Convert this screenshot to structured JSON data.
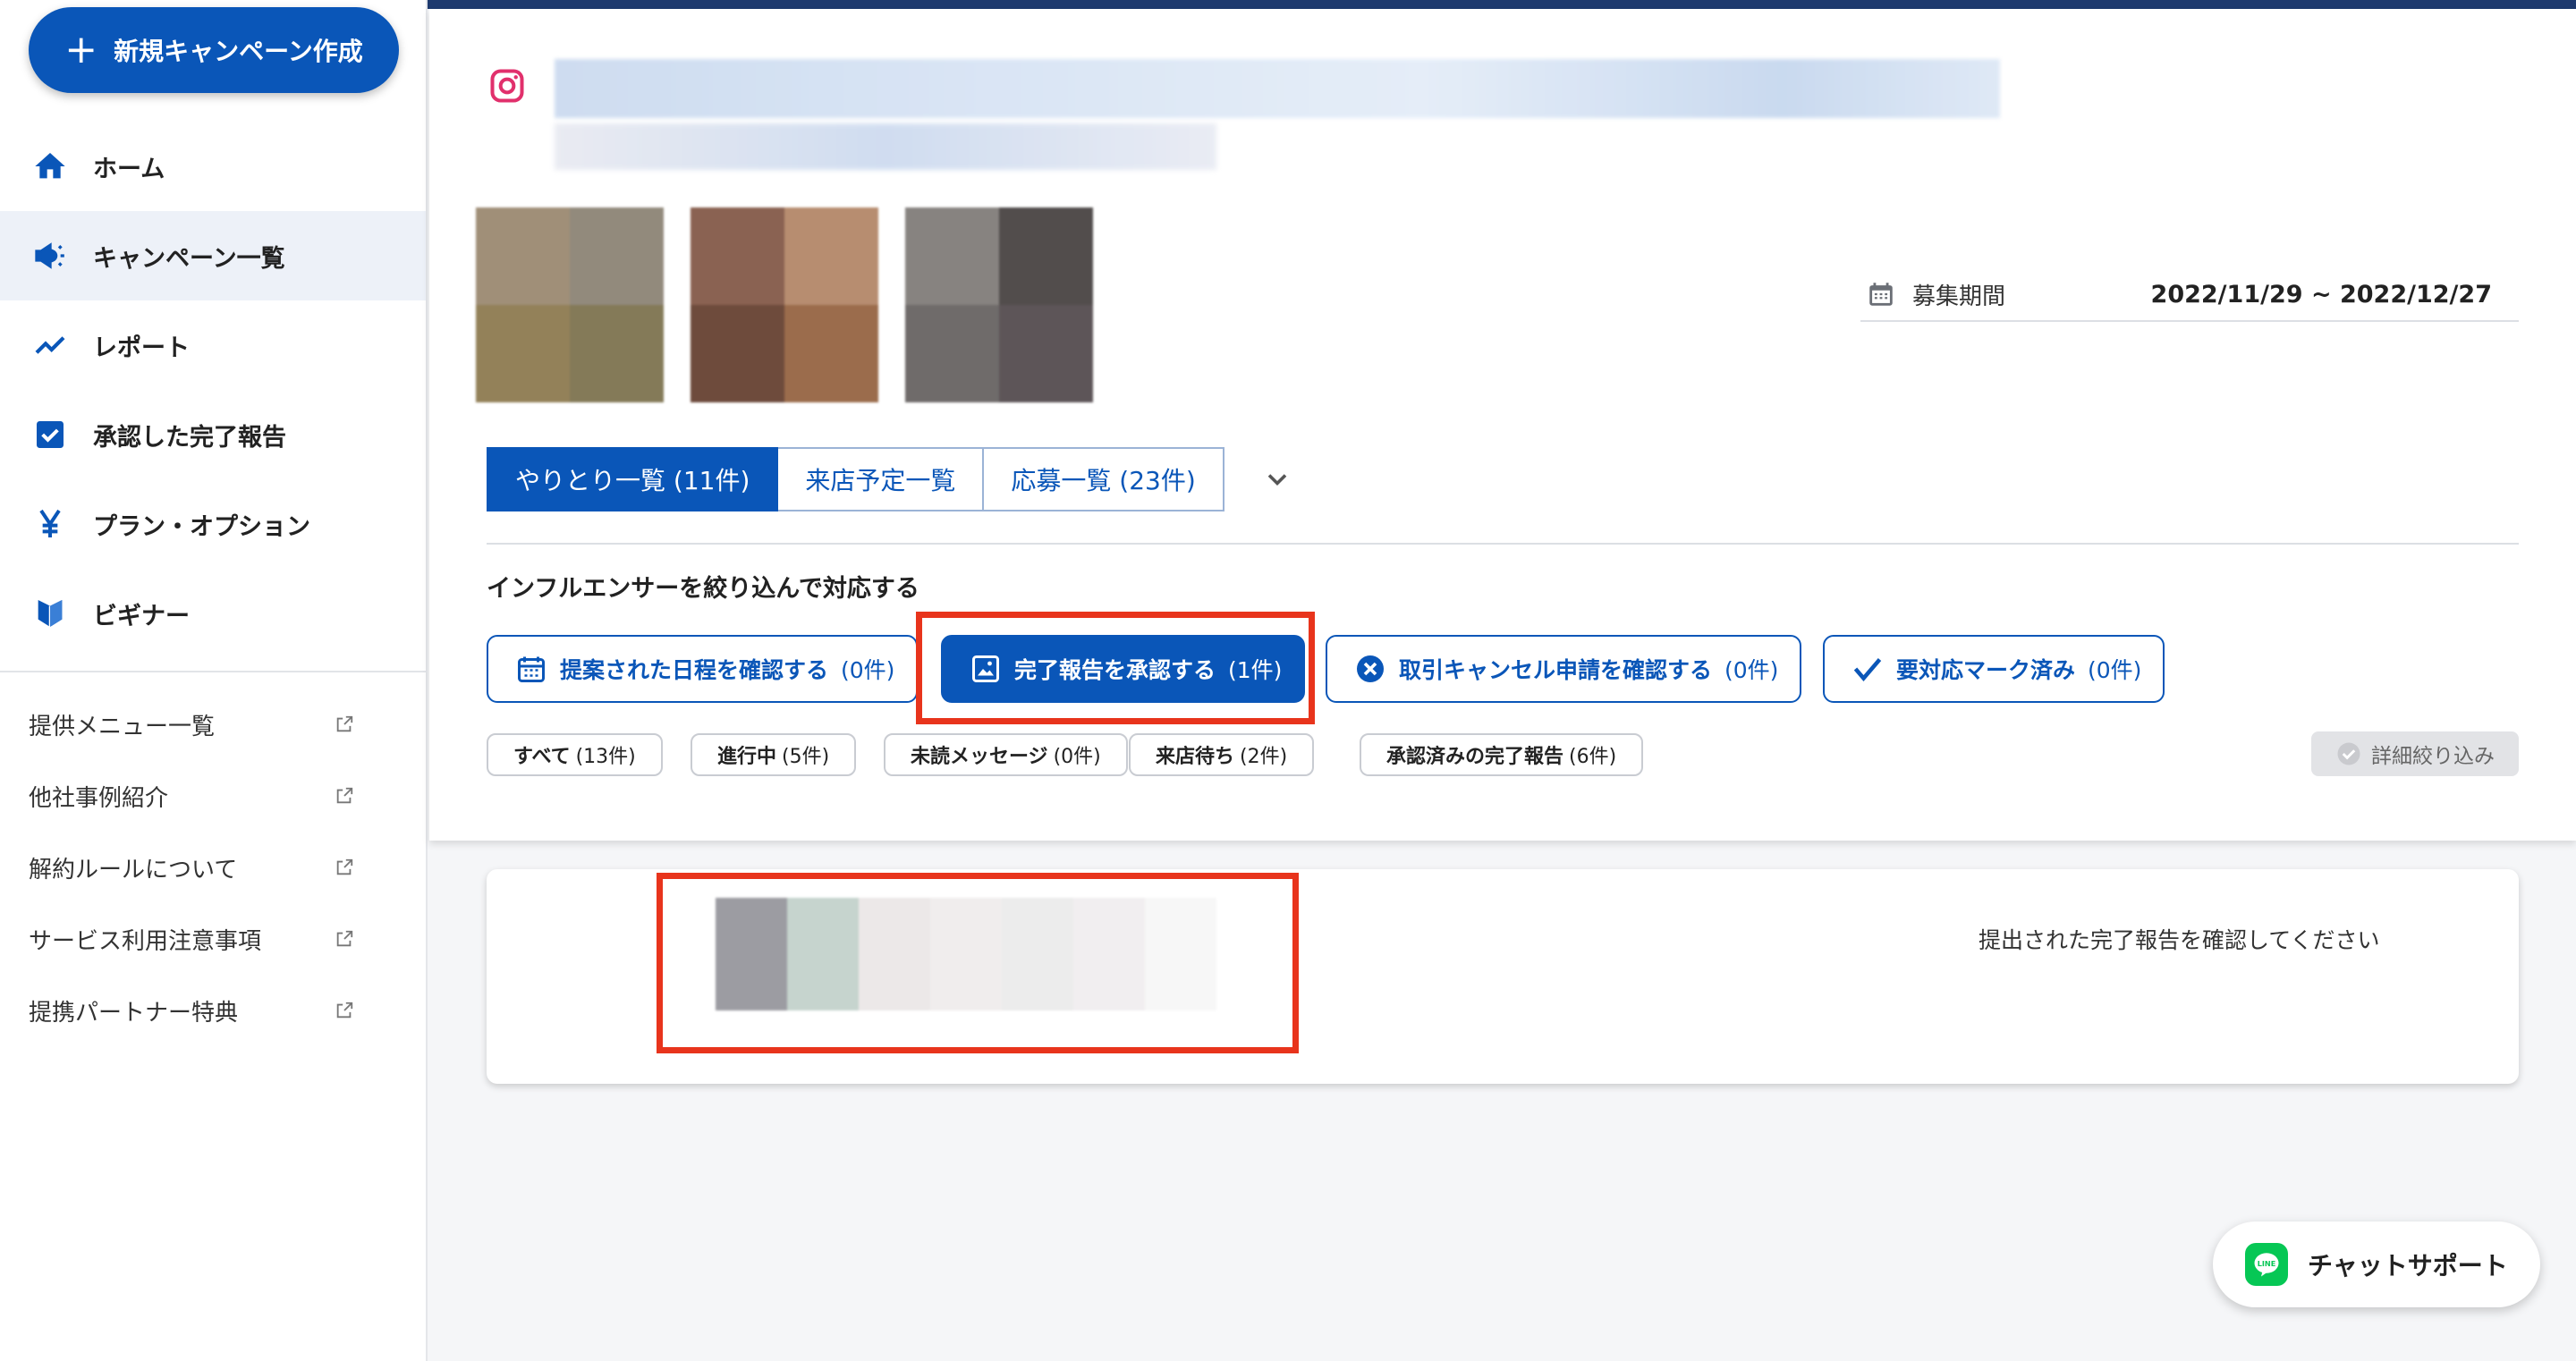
{
  "sidebar": {
    "new_campaign_label": "新規キャンペーン作成",
    "nav": [
      {
        "label": "ホーム",
        "icon": "home-icon"
      },
      {
        "label": "キャンペーン一覧",
        "icon": "megaphone-icon"
      },
      {
        "label": "レポート",
        "icon": "trend-icon"
      },
      {
        "label": "承認した完了報告",
        "icon": "checkbox-icon"
      },
      {
        "label": "プラン・オプション",
        "icon": "yen-icon"
      },
      {
        "label": "ビギナー",
        "icon": "beginner-mark-icon"
      }
    ],
    "links": [
      {
        "label": "提供メニュー一覧"
      },
      {
        "label": "他社事例紹介"
      },
      {
        "label": "解約ルールについて"
      },
      {
        "label": "サービス利用注意事項"
      },
      {
        "label": "提携パートナー特典"
      }
    ]
  },
  "campaign": {
    "period_label": "募集期間",
    "period_value": "2022/11/29 ~ 2022/12/27"
  },
  "tabs": [
    {
      "label": "やりとり一覧 (11件)",
      "active": true
    },
    {
      "label": "来店予定一覧",
      "active": false
    },
    {
      "label": "応募一覧 (23件)",
      "active": false
    }
  ],
  "filter": {
    "title": "インフルエンサーを絞り込んで対応する",
    "actions": [
      {
        "label": "提案された日程を確認する",
        "count": "(0件)"
      },
      {
        "label": "完了報告を承認する",
        "count": "(1件)"
      },
      {
        "label": "取引キャンセル申請を確認する",
        "count": "(0件)"
      },
      {
        "label": "要対応マーク済み",
        "count": "(0件)"
      }
    ],
    "chips": [
      {
        "label": "すべて",
        "count": "(13件)"
      },
      {
        "label": "進行中",
        "count": "(5件)"
      },
      {
        "label": "未読メッセージ",
        "count": "(0件)"
      },
      {
        "label": "来店待ち",
        "count": "(2件)"
      },
      {
        "label": "承認済みの完了報告",
        "count": "(6件)"
      }
    ],
    "detail_label": "詳細絞り込み"
  },
  "card": {
    "message": "提出された完了報告を確認してください"
  },
  "chat": {
    "label": "チャットサポート",
    "line_icon_text": "LINE"
  },
  "colors": {
    "primary": "#0a56b8",
    "highlight": "#e8341c",
    "line_green": "#06c755"
  }
}
